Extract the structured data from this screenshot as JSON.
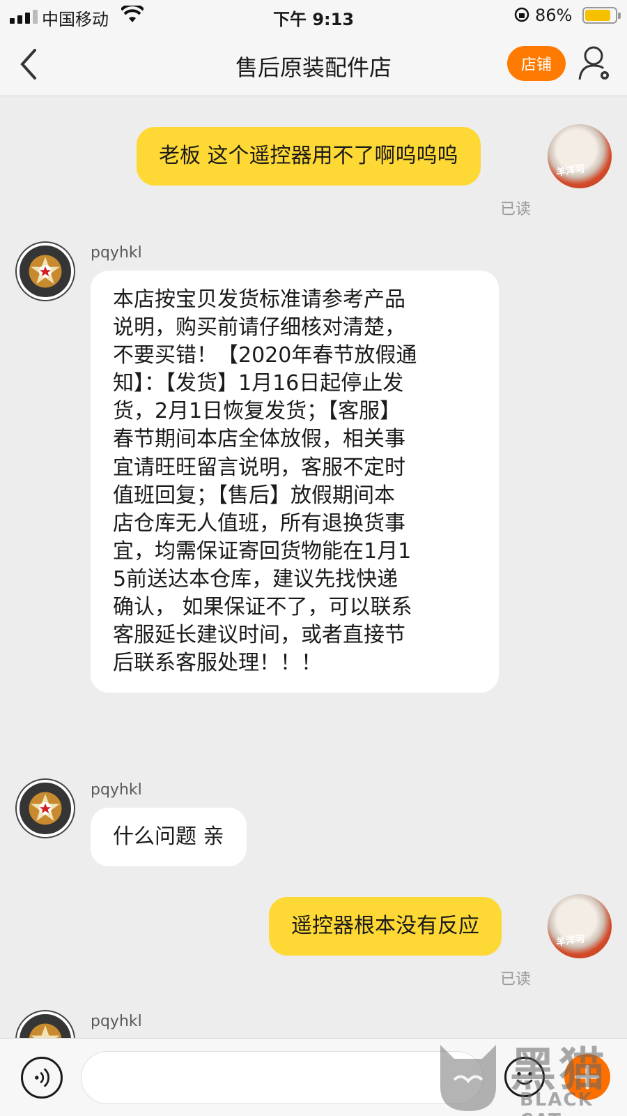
{
  "status_bar": {
    "carrier": "中国移动",
    "time": "下午 9:13",
    "battery_pct_text": "86%",
    "battery_level": 0.86
  },
  "nav": {
    "title": "售后原装配件店",
    "shop_button": "店铺"
  },
  "messages": [
    {
      "from": "me",
      "text": "老板 这个遥控器用不了啊呜呜呜",
      "status": "已读"
    },
    {
      "from": "shop",
      "sender": "pqyhkl",
      "lines": [
        "本店按宝贝发货标准请参考产品",
        "说明，购买前请仔细核对清楚，",
        "不要买错！【2020年春节放假通",
        "知】：【发货】1月16日起停止发",
        "货，2月1日恢复发货；【客服】",
        "春节期间本店全体放假，相关事",
        "宜请旺旺留言说明，客服不定时",
        "值班回复；【售后】放假期间本",
        "店仓库无人值班，所有退换货事",
        "宜，均需保证寄回货物能在1月1",
        "5前送达本仓库，建议先找快递",
        "确认， 如果保证不了，可以联系",
        "客服延长建议时间，或者直接节",
        "后联系客服处理！！！"
      ]
    },
    {
      "from": "shop",
      "sender": "pqyhkl",
      "text": "什么问题 亲"
    },
    {
      "from": "me",
      "text": "遥控器根本没有反应",
      "status": "已读"
    },
    {
      "from": "shop",
      "sender": "pqyhkl"
    }
  ],
  "avatar_me_label": "羊洋可",
  "input": {
    "placeholder": ""
  },
  "watermark": {
    "cn": "黑猫",
    "en": "BLACK CAT"
  },
  "colors": {
    "accent": "#ff7a00",
    "my_bubble": "#fed835",
    "background": "#ededed"
  },
  "icons": [
    "back-chevron-icon",
    "user-settings-icon",
    "voice-icon",
    "emoji-icon",
    "plus-icon",
    "star-badge-icon"
  ]
}
